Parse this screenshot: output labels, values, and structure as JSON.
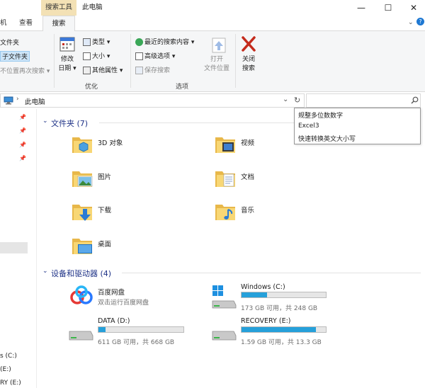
{
  "window": {
    "context_tab": "搜索工具",
    "title": "此电脑",
    "minimize": "—",
    "maximize": "☐",
    "close": "✕"
  },
  "ribbon_tabs": [
    "机",
    "查看",
    "搜索"
  ],
  "ribbon": {
    "location": {
      "item1": "文件夹",
      "item2": "子文件夹",
      "item3": "不位置再次搜索"
    },
    "refine": {
      "date_modified_l1": "修改",
      "date_modified_l2": "日期",
      "kind": "类型",
      "size": "大小",
      "other_props": "其他属性",
      "group_label": "优化"
    },
    "options": {
      "recent_searches": "最近的搜索内容",
      "advanced_options": "高级选项",
      "save_search": "保存搜索",
      "open_location_l1": "打开",
      "open_location_l2": "文件位置",
      "group_label": "选项"
    },
    "close": {
      "l1": "关闭",
      "l2": "搜索"
    }
  },
  "address": {
    "path": "此电脑",
    "dropdown": "⌄",
    "refresh": "↻",
    "search_icon": "search-icon"
  },
  "suggestions": [
    "规整多位数数字",
    "Excel3",
    "快速转换英文大小写"
  ],
  "nav": {
    "bottom_items": [
      "s (C:)",
      "(E:)",
      "RY (E:)"
    ]
  },
  "folders": {
    "title": "文件夹 (7)",
    "items": [
      "3D 对象",
      "视频",
      "图片",
      "文档",
      "下载",
      "音乐",
      "桌面"
    ]
  },
  "drives": {
    "title": "设备和驱动器 (4)",
    "items": [
      {
        "name": "百度网盘",
        "sub": "双击运行百度网盘"
      },
      {
        "name": "Windows (C:)",
        "sub": "173 GB 可用，共 248 GB",
        "used_fraction": 0.3
      },
      {
        "name": "DATA (D:)",
        "sub": "611 GB 可用，共 668 GB",
        "used_fraction": 0.085
      },
      {
        "name": "RECOVERY (E:)",
        "sub": "1.59 GB 可用，共 13.3 GB",
        "used_fraction": 0.88
      }
    ]
  },
  "colors": {
    "accent": "#26a0da",
    "folder": "#f8d775",
    "section_title": "#1e3287",
    "close_x": "#c42b1c"
  }
}
